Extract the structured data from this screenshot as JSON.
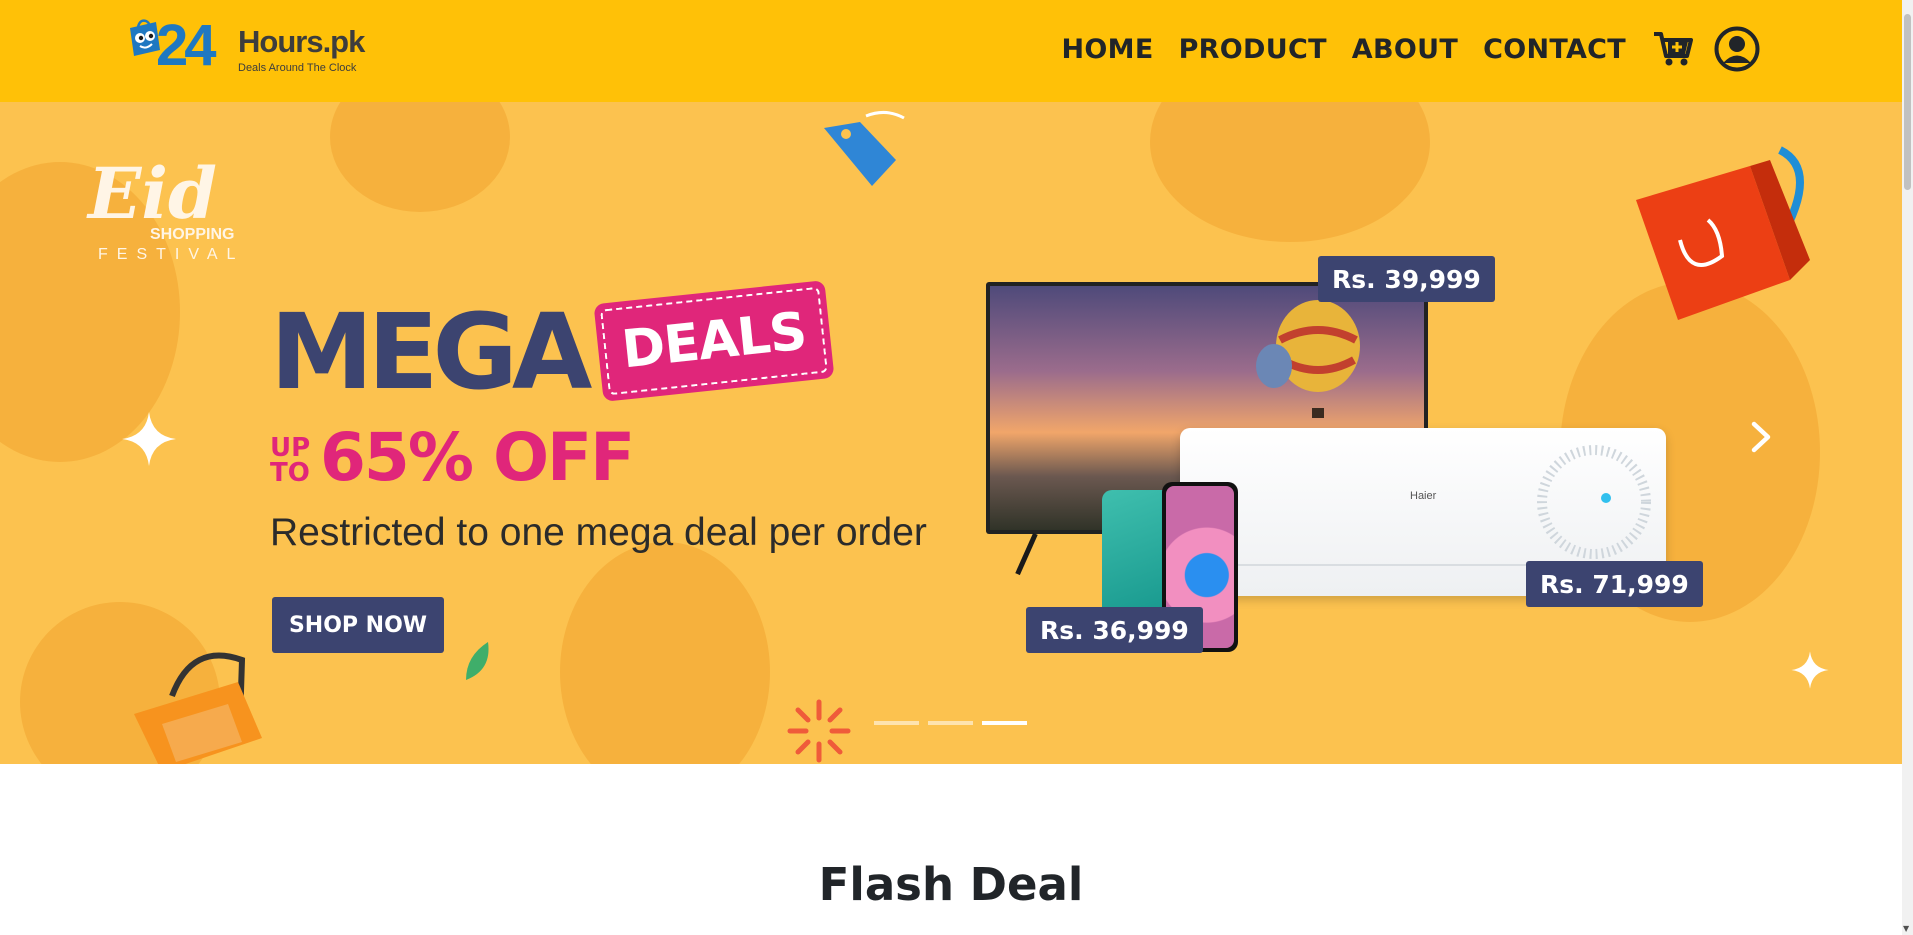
{
  "header": {
    "logo": {
      "digits": "24",
      "name": "Hours.pk",
      "tagline": "Deals Around The Clock"
    },
    "nav": [
      {
        "label": "HOME"
      },
      {
        "label": "PRODUCT"
      },
      {
        "label": "ABOUT"
      },
      {
        "label": "CONTACT"
      }
    ],
    "icons": {
      "cart": "cart-plus-icon",
      "account": "user-circle-icon"
    }
  },
  "hero": {
    "badge": {
      "title": "Eid",
      "line1": "SHOPPING",
      "line2": "FESTIVAL"
    },
    "headline": "MEGA",
    "tag": "DEALS",
    "upto": "UP TO",
    "discount": "65% OFF",
    "subtitle": "Restricted to one mega deal per order",
    "cta": "SHOP NOW",
    "products": {
      "ac_brand": "Haier"
    },
    "prices": {
      "tv": "Rs. 39,999",
      "ac": "Rs. 71,999",
      "phone": "Rs. 36,999"
    },
    "carousel": {
      "slides": 3,
      "active_index": 2,
      "next_icon": "chevron-right-icon"
    }
  },
  "section": {
    "title": "Flash Deal"
  },
  "colors": {
    "header_bg": "#ffc107",
    "hero_bg": "#fcc24f",
    "navy": "#3c4470",
    "pink": "#e0267a",
    "text_dark": "#212529"
  }
}
